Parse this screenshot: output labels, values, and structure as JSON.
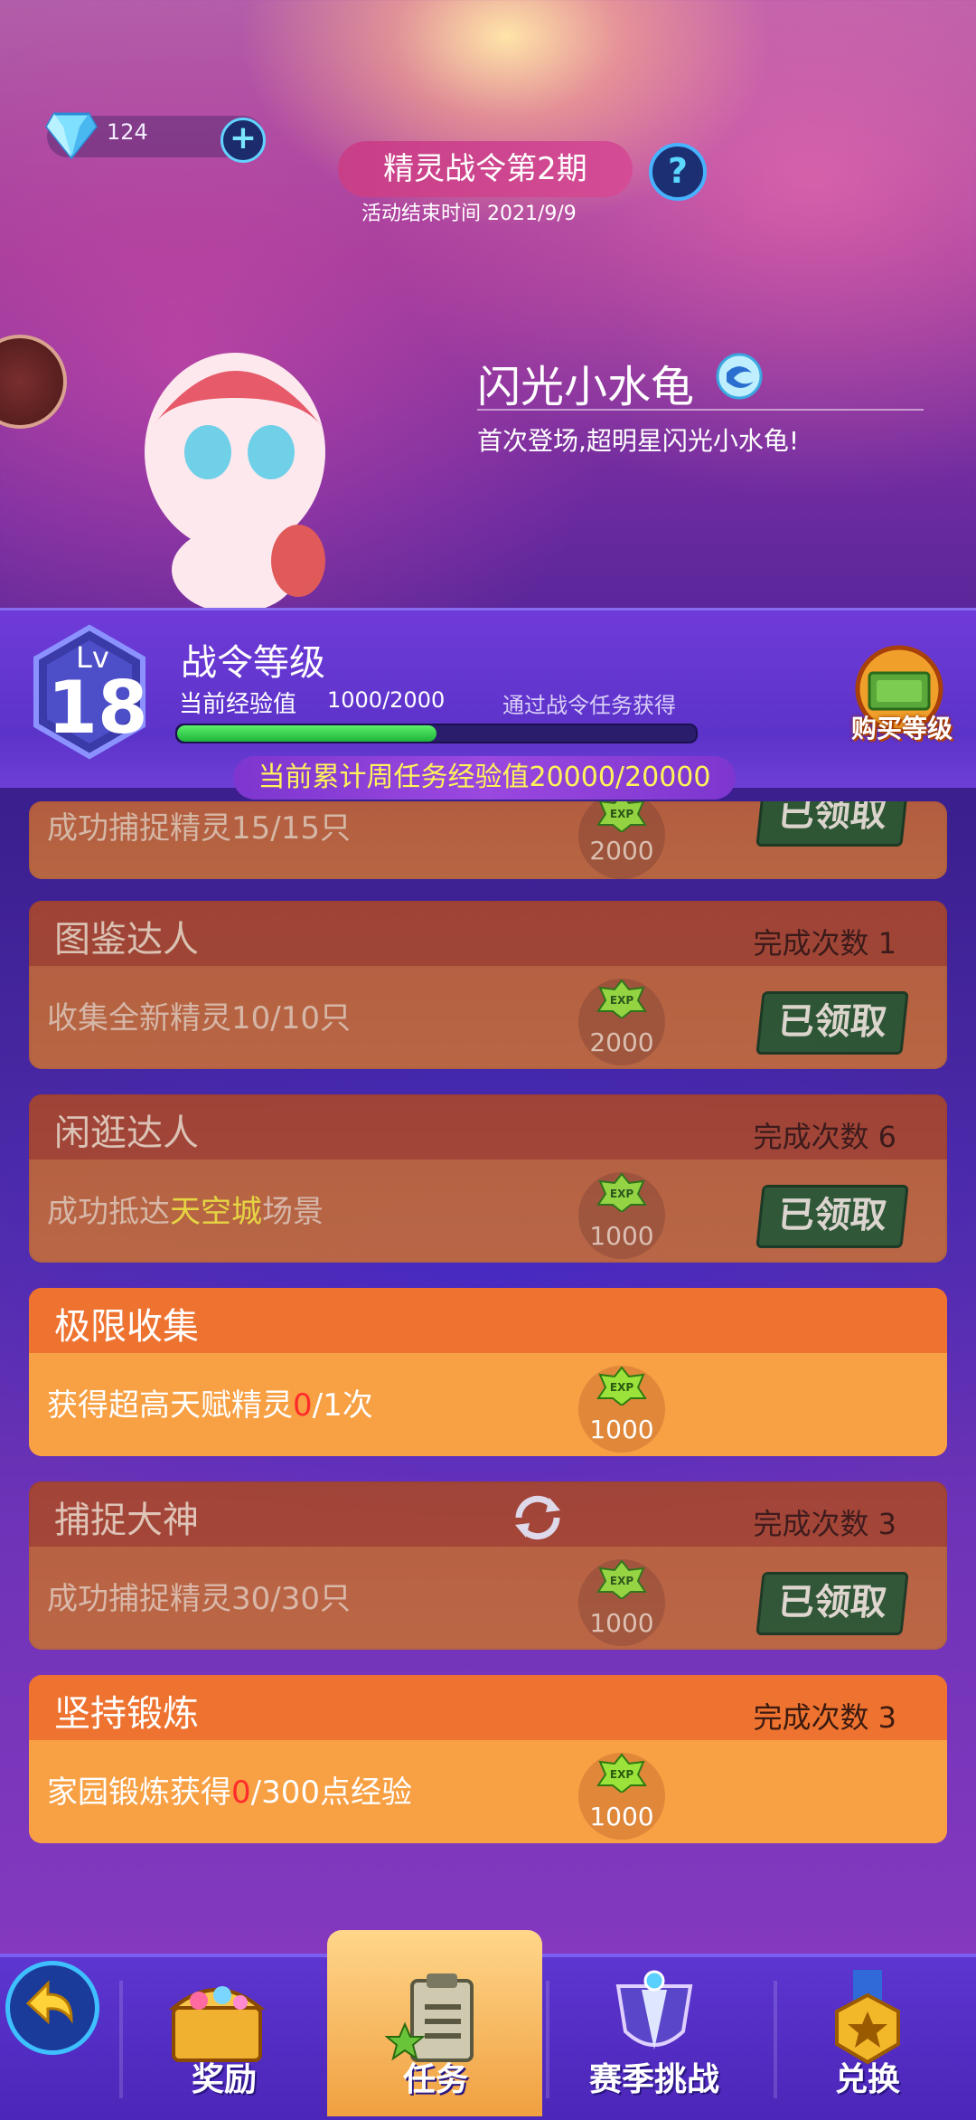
{
  "header": {
    "gems": "124",
    "title": "精灵战令第2期",
    "help": "?",
    "end_time": "活动结束时间 2021/9/9"
  },
  "pet": {
    "name": "闪光小水龟",
    "description": "首次登场,超明星闪光小水龟!"
  },
  "level": {
    "lv_label": "Lv",
    "lv_value": "18",
    "title": "战令等级",
    "exp_label": "当前经验值",
    "exp_value": "1000/2000",
    "exp_fraction": 0.5,
    "hint": "通过战令任务获得",
    "buy_label": "购买等级",
    "weekly": "当前累计周任务经验值20000/20000"
  },
  "tasks": [
    {
      "desc": "成功捕捉精灵15/15只",
      "exp": "2000",
      "claimed": "已领取"
    },
    {
      "name": "图鉴达人",
      "count": "完成次数 1",
      "desc": "收集全新精灵10/10只",
      "exp": "2000",
      "claimed": "已领取"
    },
    {
      "name": "闲逛达人",
      "count": "完成次数 6",
      "desc_pre": "成功抵达",
      "desc_hl": "天空城",
      "desc_post": "场景",
      "exp": "1000",
      "claimed": "已领取"
    },
    {
      "name": "极限收集",
      "desc_pre": "获得超高天赋精灵",
      "desc_hl": "0",
      "desc_post": "/1次",
      "exp": "1000"
    },
    {
      "name": "捕捉大神",
      "count": "完成次数 3",
      "desc": "成功捕捉精灵30/30只",
      "exp": "1000",
      "claimed": "已领取"
    },
    {
      "name": "坚持锻炼",
      "count": "完成次数 3",
      "desc_pre": "家园锻炼获得",
      "desc_hl": "0",
      "desc_post": "/300点经验",
      "exp": "1000"
    }
  ],
  "nav": {
    "rewards": "奖励",
    "tasks": "任务",
    "season": "赛季挑战",
    "exchange": "兑换"
  },
  "icons": [
    "diamond-icon",
    "plus-icon",
    "help-icon",
    "water-type-icon",
    "level-hex-icon",
    "money-icon",
    "exp-icon",
    "refresh-icon",
    "back-arrow-icon",
    "treasure-chest-icon",
    "clipboard-icon",
    "trophy-icon",
    "medal-icon"
  ]
}
